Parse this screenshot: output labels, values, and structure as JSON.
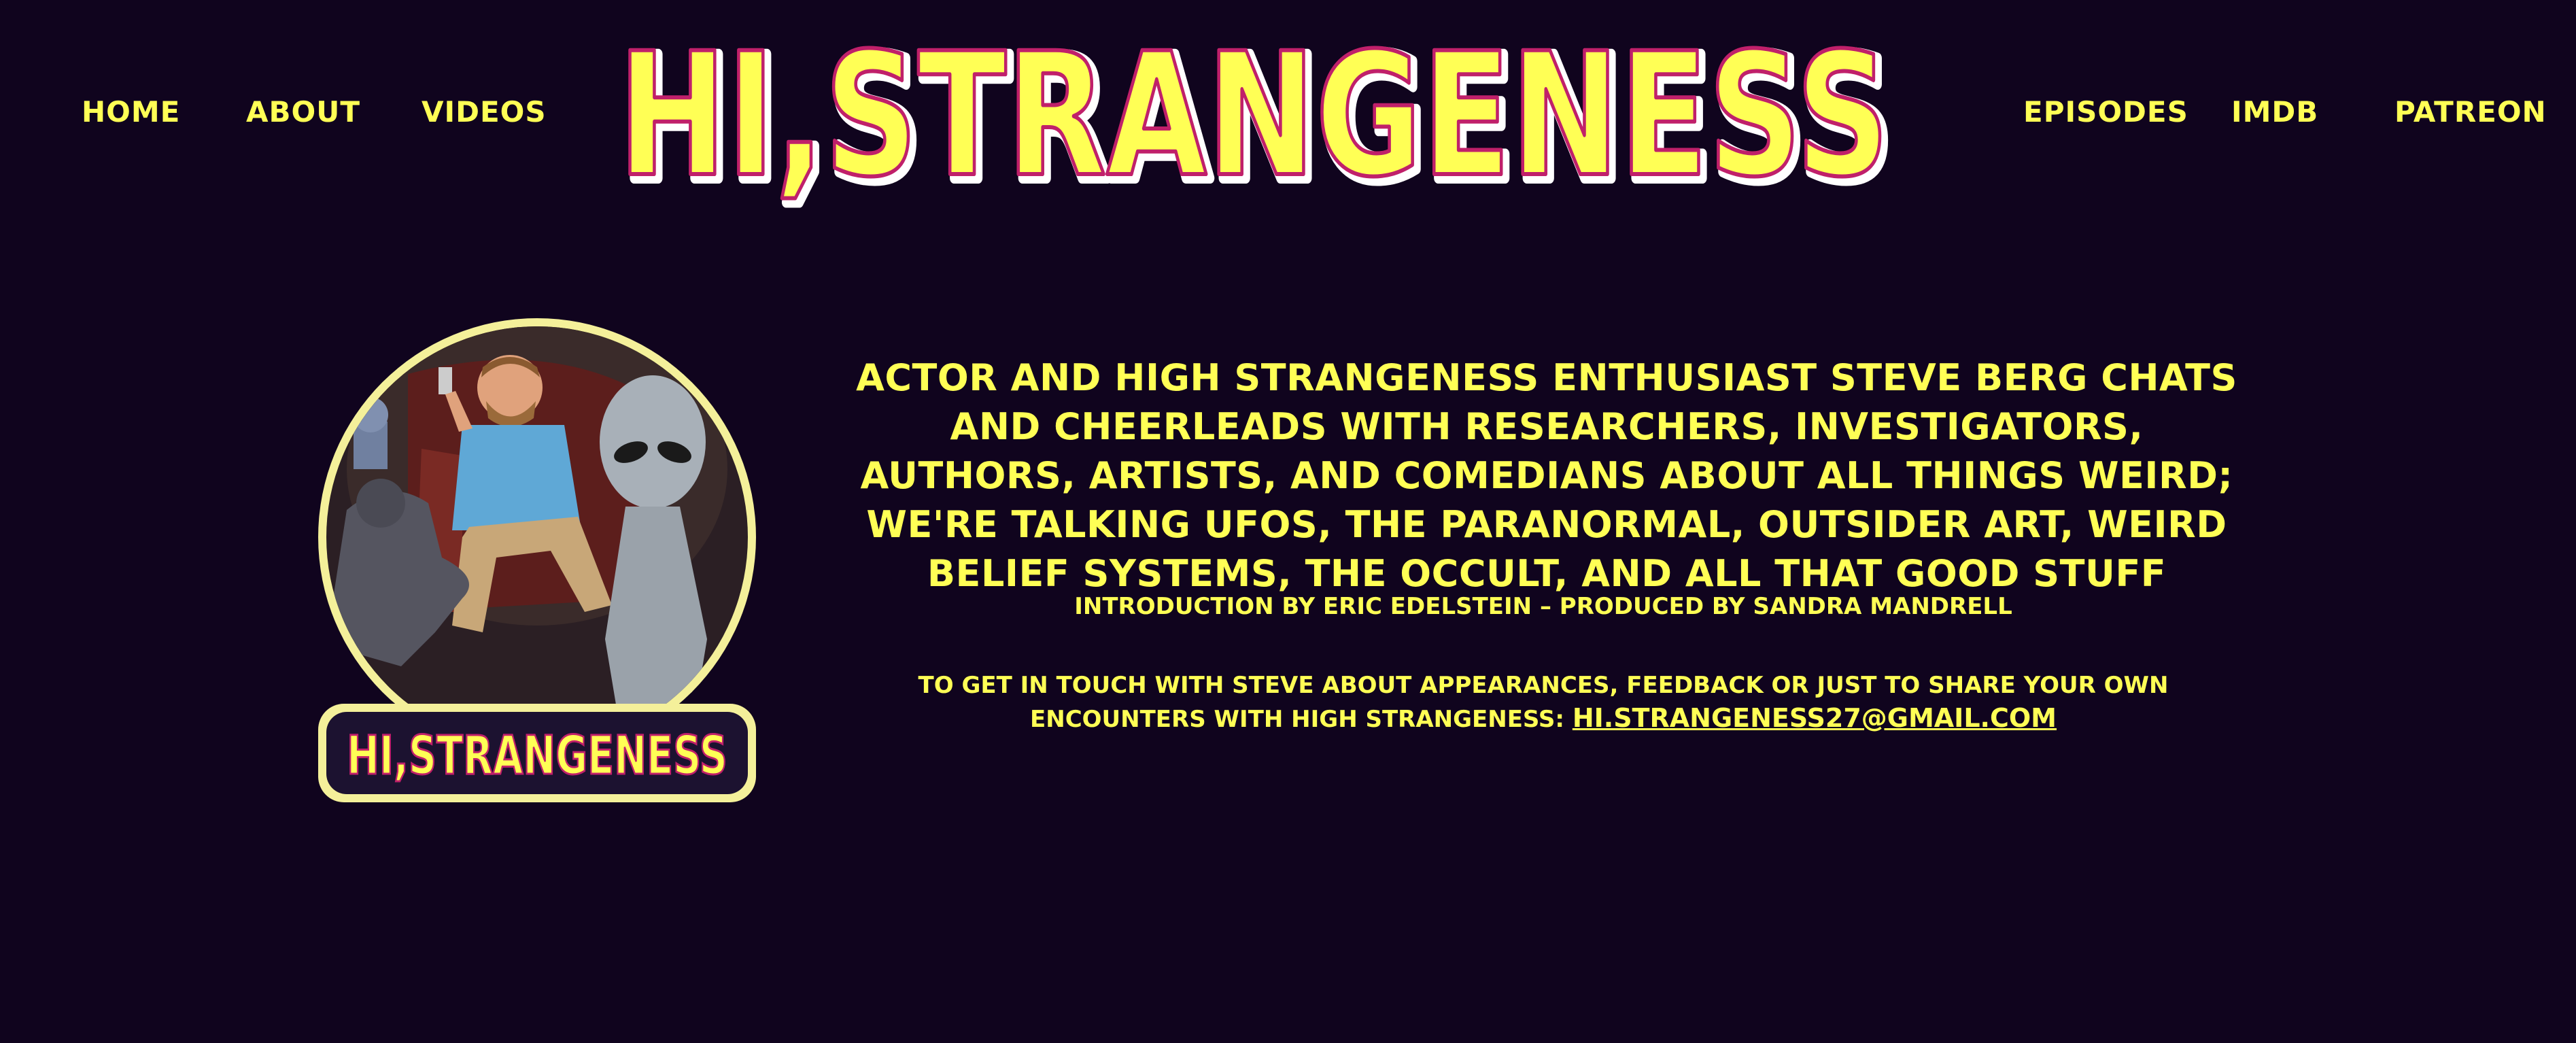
{
  "nav": {
    "home": "HOME",
    "about": "ABOUT",
    "videos": "VIDEOS",
    "episodes": "EPISODES",
    "imdb": "IMDB",
    "patreon": "PATREON"
  },
  "logo": {
    "text": "HI,STRANGENESS"
  },
  "badge": {
    "text": "HI,STRANGENESS"
  },
  "description": "ACTOR AND HIGH STRANGENESS ENTHUSIAST STEVE BERG CHATS AND CHEERLEADS WITH RESEARCHERS, INVESTIGATORS, AUTHORS, ARTISTS, AND COMEDIANS ABOUT ALL THINGS WEIRD; WE'RE TALKING UFOS, THE PARANORMAL, OUTSIDER ART, WEIRD BELIEF SYSTEMS, THE OCCULT, AND ALL THAT GOOD STUFF",
  "credits": "INTRODUCTION BY ERIC EDELSTEIN – PRODUCED BY SANDRA MANDRELL",
  "contact": {
    "text": "TO GET IN TOUCH WITH STEVE ABOUT APPEARANCES, FEEDBACK OR JUST TO SHARE YOUR OWN ENCOUNTERS WITH HIGH STRANGENESS: ",
    "email": "HI.STRANGENESS27@GMAIL.COM"
  },
  "colors": {
    "background": "#10041e",
    "accent": "#ffff55",
    "logo_outline": "#c0206a",
    "badge_ring": "#f4f09a"
  }
}
